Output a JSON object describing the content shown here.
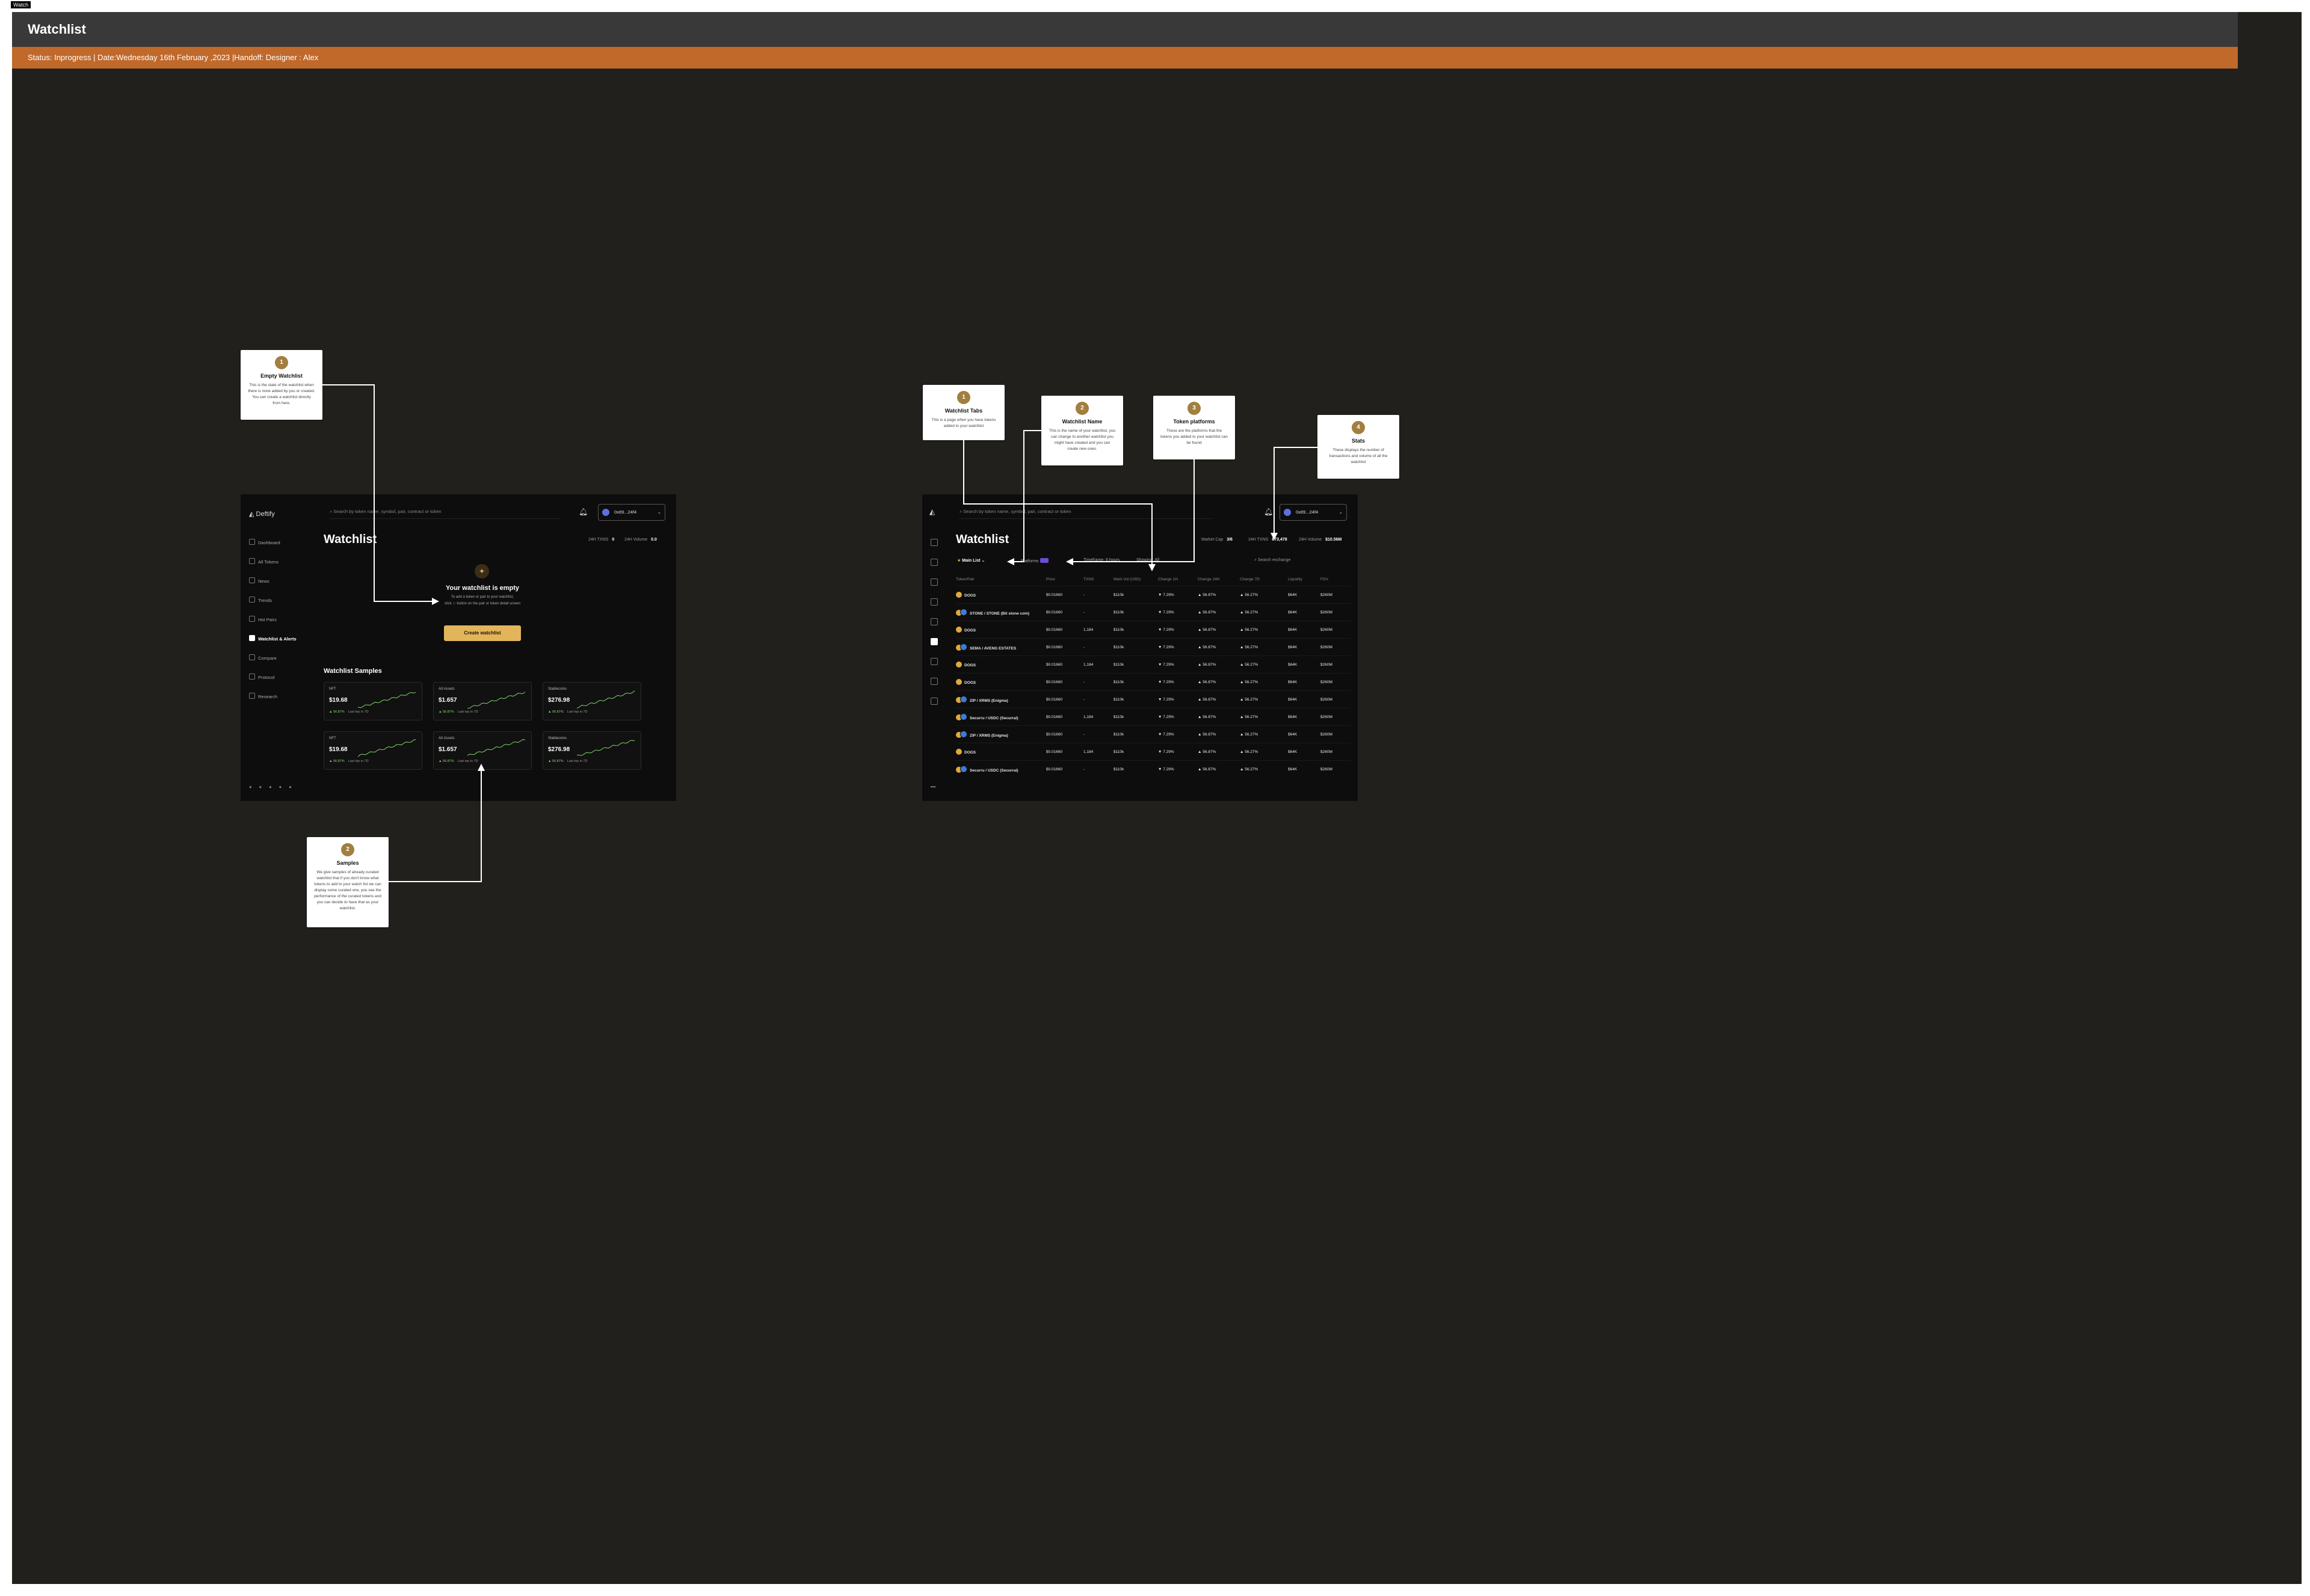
{
  "frame_tag": "Watch",
  "header": {
    "title": "Watchlist",
    "status": "Status: Inprogress | Date:Wednesday 16th February ,2023 |Handoff: Designer : Alex"
  },
  "annotations": [
    {
      "num": "1",
      "title": "Empty Watchlist",
      "body": "This is the state of the watchlist when there is none added by you or created. You can create a watchlist directly from here."
    },
    {
      "num": "2",
      "title": "Samples",
      "body": "We give samples of already curated watchlist that if you don't know what tokens to add to your watch list we can display some curated one, you see the performance of the curated tokens and you can decide to have that as your watchlist."
    },
    {
      "num": "1",
      "title": "Watchlist Tabs",
      "body": "This is a page when you have tokens added to your watchlist"
    },
    {
      "num": "2",
      "title": "Watchlist Name",
      "body": "This is the name of your watchlist, you can change to another watchlist you might have created and you can create new ones."
    },
    {
      "num": "3",
      "title": "Token platforms",
      "body": "These are the platforms that the tokens you added to your watchlist can be found"
    },
    {
      "num": "4",
      "title": "Stats",
      "body": "These displays the number of transactions and volume of all the watchlist"
    }
  ],
  "app": {
    "brand": "Deftify",
    "search_placeholder": "Search by token name, symbol, pair, contract or token",
    "wallet": "0x89...24f4",
    "nav": [
      "Dashboard",
      "All Tokens",
      "News",
      "Trends",
      "Hot Pairs",
      "Watchlist & Alerts",
      "Compare",
      "Protocol",
      "Research"
    ],
    "page_title": "Watchlist"
  },
  "empty": {
    "stats": [
      {
        "label": "24H TXNS",
        "value": "0"
      },
      {
        "label": "24H Volume",
        "value": "0.0"
      }
    ],
    "empty_title": "Your watchlist is empty",
    "empty_line1": "To add a token or pair to your watchlist,",
    "empty_line2": "click ☆ button on the pair or token detail screen",
    "create_label": "Create watchlist",
    "samples_title": "Watchlist Samples",
    "samples": [
      {
        "name": "NFT",
        "value": "$19.68",
        "change": "▲ 56.87%",
        "note": "Last top in 7D"
      },
      {
        "name": "AII Assets",
        "value": "$1.657",
        "change": "▲ 56.87%",
        "note": "Last top in 7D"
      },
      {
        "name": "Stablecoins",
        "value": "$276.98",
        "change": "▲ 56.87%",
        "note": "Last top in 7D"
      },
      {
        "name": "NFT",
        "value": "$19.68",
        "change": "▲ 56.87%",
        "note": "Last top in 7D"
      },
      {
        "name": "AII Assets",
        "value": "$1.657",
        "change": "▲ 56.87%",
        "note": "Last top in 7D"
      },
      {
        "name": "Stablecoins",
        "value": "$276.98",
        "change": "▲ 56.87%",
        "note": "Last top in 7D"
      }
    ]
  },
  "filled": {
    "stats": [
      {
        "label": "Market Cap",
        "value": "3/6"
      },
      {
        "label": "24H TXNS",
        "value": "673,478"
      },
      {
        "label": "24H Volume",
        "value": "$10.56M"
      }
    ],
    "tab_main": "Main List",
    "platforms_label": "Platforms",
    "timeframe_label": "Timeframe: 6 hours",
    "showing": "Showing: All",
    "search_exchange": "Search exchange",
    "columns": [
      "Token/Pair",
      "Price",
      "TXNS",
      "Mark Vol (USD)",
      "Change 1H",
      "Change 24H",
      "Change 7D",
      "Liquidity",
      "FDV"
    ],
    "rows": [
      [
        "DOGS",
        "$0.01660",
        "-",
        "$110k",
        "▼ 7.29%",
        "▲ 56.87%",
        "▲ 56.27%",
        "$64K",
        "$260M"
      ],
      [
        "STONE / STONE (Bit stone coin)",
        "$0.01660",
        "-",
        "$110k",
        "▼ 7.29%",
        "▲ 56.87%",
        "▲ 56.27%",
        "$64K",
        "$260M"
      ],
      [
        "DOGS",
        "$0.01660",
        "1,184",
        "$110k",
        "▼ 7.29%",
        "▲ 56.87%",
        "▲ 56.27%",
        "$64K",
        "$260M"
      ],
      [
        "SEMA / AVENG ESTATES",
        "$0.01660",
        "-",
        "$110k",
        "▼ 7.29%",
        "▲ 56.87%",
        "▲ 56.27%",
        "$64K",
        "$260M"
      ],
      [
        "DOGS",
        "$0.01660",
        "1,184",
        "$110k",
        "▼ 7.29%",
        "▲ 56.87%",
        "▲ 56.27%",
        "$64K",
        "$260M"
      ],
      [
        "DOGS",
        "$0.01660",
        "-",
        "$110k",
        "▼ 7.29%",
        "▲ 56.87%",
        "▲ 56.27%",
        "$64K",
        "$260M"
      ],
      [
        "ZIP / XRMS (Enigma)",
        "$0.01660",
        "-",
        "$110k",
        "▼ 7.29%",
        "▲ 56.87%",
        "▲ 56.27%",
        "$64K",
        "$260M"
      ],
      [
        "Securru / USDC (Securrai)",
        "$0.01660",
        "1,184",
        "$110k",
        "▼ 7.29%",
        "▲ 56.87%",
        "▲ 56.27%",
        "$64K",
        "$260M"
      ],
      [
        "ZIP / XRMS (Enigma)",
        "$0.01660",
        "-",
        "$110k",
        "▼ 7.29%",
        "▲ 56.87%",
        "▲ 56.27%",
        "$64K",
        "$260M"
      ],
      [
        "DOGS",
        "$0.01660",
        "1,184",
        "$110k",
        "▼ 7.29%",
        "▲ 56.87%",
        "▲ 56.27%",
        "$64K",
        "$260M"
      ],
      [
        "Securru / USDC (Securrai)",
        "$0.01660",
        "-",
        "$110k",
        "▼ 7.29%",
        "▲ 56.87%",
        "▲ 56.27%",
        "$64K",
        "$260M"
      ]
    ]
  }
}
